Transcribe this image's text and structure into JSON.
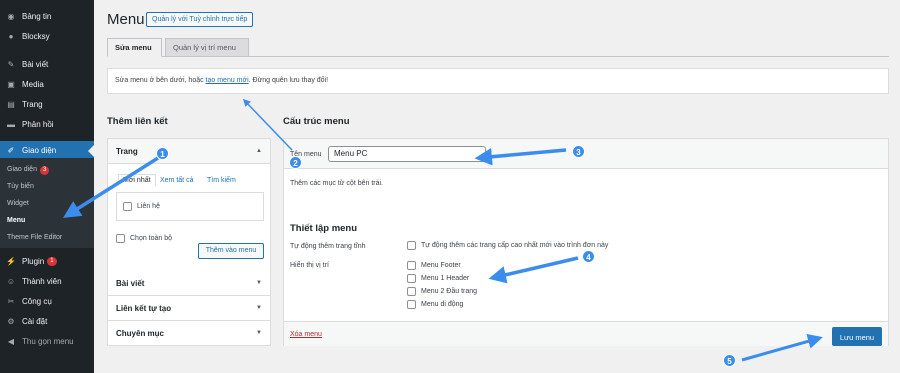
{
  "sidebar": {
    "items": [
      {
        "label": "Bảng tin",
        "icon": "dashboard-icon"
      },
      {
        "label": "Blocksy",
        "icon": "blocksy-icon"
      },
      {
        "label": "Bài viết",
        "icon": "pin-icon"
      },
      {
        "label": "Media",
        "icon": "media-icon"
      },
      {
        "label": "Trang",
        "icon": "page-icon"
      },
      {
        "label": "Phản hồi",
        "icon": "comment-icon"
      },
      {
        "label": "Giao diện",
        "icon": "brush-icon"
      },
      {
        "label": "Plugin",
        "icon": "plugin-icon",
        "badge": "1"
      },
      {
        "label": "Thành viên",
        "icon": "users-icon"
      },
      {
        "label": "Công cụ",
        "icon": "tools-icon"
      },
      {
        "label": "Cài đặt",
        "icon": "settings-icon"
      },
      {
        "label": "Thu gọn menu",
        "icon": "collapse-icon"
      }
    ],
    "submenu": [
      {
        "label": "Giao diện",
        "badge": "3"
      },
      {
        "label": "Tùy biến"
      },
      {
        "label": "Widget"
      },
      {
        "label": "Menu"
      },
      {
        "label": "Theme File Editor"
      }
    ]
  },
  "header": {
    "title": "Menu",
    "live_button": "Quản lý với Tuỳ chỉnh trực tiếp"
  },
  "tabs": [
    {
      "label": "Sửa menu"
    },
    {
      "label": "Quản lý vị trí menu"
    }
  ],
  "notice": {
    "before": "Sửa menu ở bên dưới, hoặc ",
    "link": "tạo menu mới",
    "after": ". Đừng quên lưu thay đổi!"
  },
  "add_links": {
    "heading": "Thêm liên kết",
    "sections": [
      "Trang",
      "Bài viết",
      "Liên kết tự tạo",
      "Chuyên mục"
    ],
    "inner_tabs": [
      "Mới nhất",
      "Xem tất cả",
      "Tìm kiếm"
    ],
    "page_item": "Liên hệ",
    "select_all": "Chọn toàn bộ",
    "add_button": "Thêm vào menu"
  },
  "structure": {
    "heading": "Cấu trúc menu",
    "name_label": "Tên menu",
    "name_value": "Menu PC",
    "hint": "Thêm các mục từ cột bên trái.",
    "settings_heading": "Thiết lập menu",
    "auto_add_label": "Tự động thêm trang tĩnh",
    "auto_add_option": "Tự động thêm các trang cấp cao nhất mới vào trình đơn này",
    "location_label": "Hiển thị vị trí",
    "locations": [
      "Menu Footer",
      "Menu 1 Header",
      "Menu 2 Đầu trang",
      "Menu di động"
    ],
    "delete_link": "Xóa menu",
    "save_button": "Lưu menu"
  },
  "annotations": [
    "1",
    "2",
    "3",
    "4",
    "5"
  ],
  "colors": {
    "accent": "#2271b1",
    "sidebar": "#1d2327",
    "annotation": "#3b8ded",
    "badge": "#d63638"
  }
}
